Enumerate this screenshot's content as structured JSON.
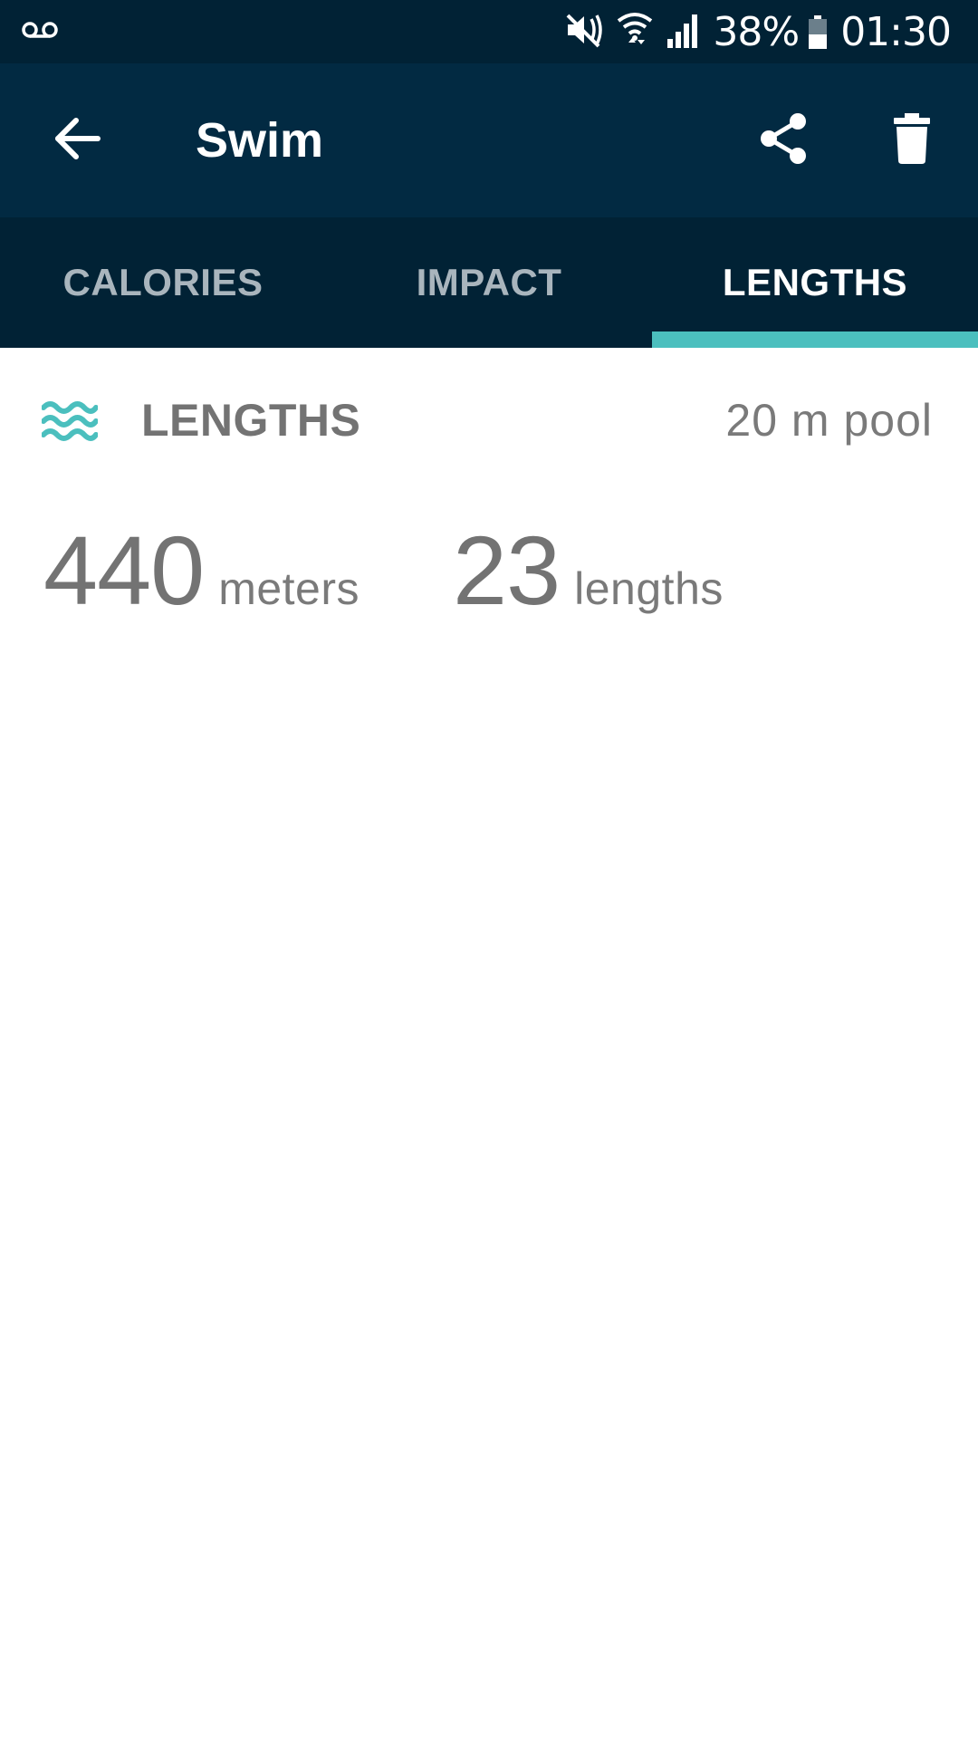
{
  "status_bar": {
    "voicemail_icon": "voicemail-icon",
    "mute_icon": "vibrate-mute-icon",
    "wifi_icon": "wifi-icon",
    "signal_icon": "signal-icon",
    "battery_percent": "38%",
    "time": "01:30"
  },
  "app_bar": {
    "back_icon": "arrow-left-icon",
    "title": "Swim",
    "share_icon": "share-icon",
    "delete_icon": "trash-icon"
  },
  "tabs": [
    {
      "label": "CALORIES",
      "active": false
    },
    {
      "label": "IMPACT",
      "active": false
    },
    {
      "label": "LENGTHS",
      "active": true
    }
  ],
  "lengths_section": {
    "icon": "waves-icon",
    "title": "LENGTHS",
    "pool_size": "20 m pool",
    "stats": [
      {
        "value": "440",
        "unit": "meters"
      },
      {
        "value": "23",
        "unit": "lengths"
      }
    ]
  },
  "colors": {
    "status_bar_bg": "#012235",
    "app_bar_bg": "#022a42",
    "tab_bar_bg": "#012235",
    "accent": "#4bbfbe",
    "text_gray": "#737373"
  }
}
